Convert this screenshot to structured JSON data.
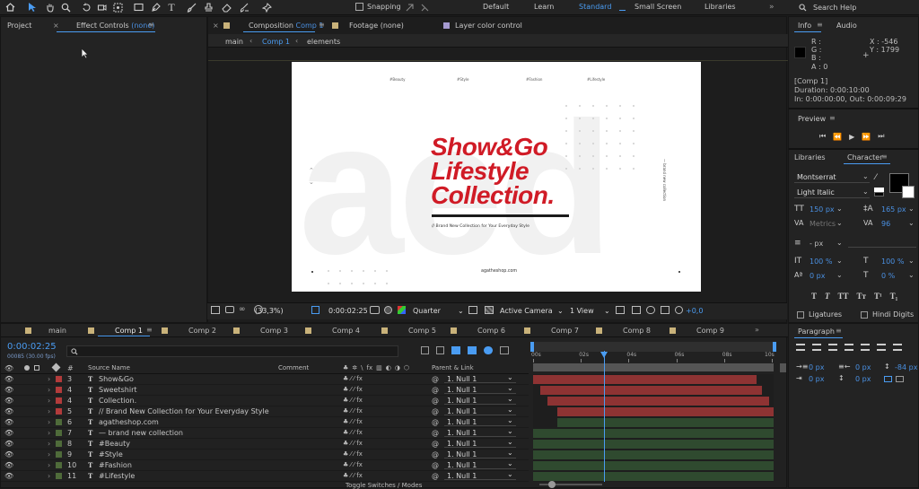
{
  "toolbar": {
    "snapping_label": "Snapping",
    "workspaces": [
      "Default",
      "Learn",
      "Standard",
      "Small Screen",
      "Libraries"
    ],
    "active_workspace": "Standard",
    "search_placeholder": "Search Help",
    "colors": {
      "accent": "#4a9cf2",
      "bg": "#232323"
    }
  },
  "left_panel": {
    "tab_project": "Project",
    "tab_effect_prefix": "Effect Controls",
    "tab_effect_value": "(none)"
  },
  "comp_viewer": {
    "tabs": [
      {
        "label": "Composition",
        "value": "Comp 1"
      },
      {
        "label": "Footage",
        "value": "(none)"
      },
      {
        "label": "Layer color control",
        "value": ""
      }
    ],
    "breadcrumbs": [
      "main",
      "Comp 1",
      "elements"
    ],
    "footer": {
      "zoom": "(33,3%)",
      "timecode": "0:00:02:25",
      "resolution": "Quarter",
      "camera": "Active Camera",
      "view": "1 View",
      "exposure": "+0,0"
    }
  },
  "comp_content": {
    "ghost_text": "aed",
    "tags": [
      "#Beauty",
      "#Style",
      "#Fashion",
      "#Lifestyle"
    ],
    "title_lines": [
      "Show&Go",
      "Lifestyle",
      "Collection."
    ],
    "subtitle": "// Brand New Collection for Your Everyday Style",
    "website": "agatheshop.com",
    "vertical_text": "— brand new collection",
    "colors": {
      "title": "#d01b26",
      "rule": "#1b1b1b",
      "bg": "#ffffff"
    }
  },
  "info_panel": {
    "tab_info": "Info",
    "tab_audio": "Audio",
    "r": "R :",
    "g": "G :",
    "b": "B :",
    "a": "A :  0",
    "x": "X : -546",
    "y": "Y : 1799",
    "comp_name": "[Comp 1]",
    "duration": "Duration: 0:00:10:00",
    "inout": "In: 0:00:00:00, Out: 0:00:09:29"
  },
  "preview": {
    "label": "Preview"
  },
  "character": {
    "tab_libraries": "Libraries",
    "tab_character": "Character",
    "font": "Montserrat",
    "style": "Light Italic",
    "size": "150 px",
    "leading": "165 px",
    "kerning": "Metrics",
    "tracking": "96",
    "stroke": "- px",
    "vscale": "100 %",
    "hscale": "100 %",
    "baseline": "0 px",
    "tsume": "0 %",
    "ligatures": "Ligatures",
    "hindi": "Hindi Digits"
  },
  "paragraph": {
    "label": "Paragraph",
    "indent_left": "0 px",
    "indent_right": "0 px",
    "space_before": "-84 px",
    "indent_first": "0 px",
    "space_after": "0 px"
  },
  "timeline": {
    "tabs": [
      "main",
      "Comp 1",
      "Comp 2",
      "Comp 3",
      "Comp 4",
      "Comp 5",
      "Comp 6",
      "Comp 7",
      "Comp 8",
      "Comp 9"
    ],
    "active_tab": "Comp 1",
    "timecode": "0:00:02:25",
    "frame_info": "00085 (30.00 fps)",
    "headers": {
      "source": "Source Name",
      "comment": "Comment",
      "parent": "Parent & Link"
    },
    "ruler": [
      "00s",
      "02s",
      "04s",
      "06s",
      "08s",
      "10s"
    ],
    "layers": [
      {
        "num": "3",
        "name": "Show&Go",
        "parent": "1. Null 1",
        "label_color": "#b23b3b",
        "bar_start": 0.0,
        "bar_end": 0.93,
        "bar_color": "#8e3333"
      },
      {
        "num": "4",
        "name": "Sweetshirt",
        "parent": "1. Null 1",
        "label_color": "#b23b3b",
        "bar_start": 0.03,
        "bar_end": 0.95,
        "bar_color": "#8e3333"
      },
      {
        "num": "4",
        "name": "Collection.",
        "parent": "1. Null 1",
        "label_color": "#b23b3b",
        "bar_start": 0.06,
        "bar_end": 0.98,
        "bar_color": "#8e3333"
      },
      {
        "num": "5",
        "name": "// Brand New Collection for Your Everyday Style",
        "parent": "1. Null 1",
        "label_color": "#b23b3b",
        "bar_start": 0.1,
        "bar_end": 1.0,
        "bar_color": "#8e3333"
      },
      {
        "num": "6",
        "name": "agatheshop.com",
        "parent": "1. Null 1",
        "label_color": "#4f6b3a",
        "bar_start": 0.1,
        "bar_end": 1.0,
        "bar_color": "#2f4a2f"
      },
      {
        "num": "7",
        "name": "— brand new collection",
        "parent": "1. Null 1",
        "label_color": "#4f6b3a",
        "bar_start": 0.0,
        "bar_end": 1.0,
        "bar_color": "#2f4a2f"
      },
      {
        "num": "8",
        "name": "#Beauty",
        "parent": "1. Null 1",
        "label_color": "#4f6b3a",
        "bar_start": 0.0,
        "bar_end": 1.0,
        "bar_color": "#2f4a2f"
      },
      {
        "num": "9",
        "name": "#Style",
        "parent": "1. Null 1",
        "label_color": "#4f6b3a",
        "bar_start": 0.0,
        "bar_end": 1.0,
        "bar_color": "#2f4a2f"
      },
      {
        "num": "10",
        "name": "#Fashion",
        "parent": "1. Null 1",
        "label_color": "#4f6b3a",
        "bar_start": 0.0,
        "bar_end": 1.0,
        "bar_color": "#2f4a2f"
      },
      {
        "num": "11",
        "name": "#Lifestyle",
        "parent": "1. Null 1",
        "label_color": "#4f6b3a",
        "bar_start": 0.0,
        "bar_end": 1.0,
        "bar_color": "#2f4a2f"
      }
    ],
    "toggle_label": "Toggle Switches / Modes",
    "playhead_fraction": 0.295
  }
}
